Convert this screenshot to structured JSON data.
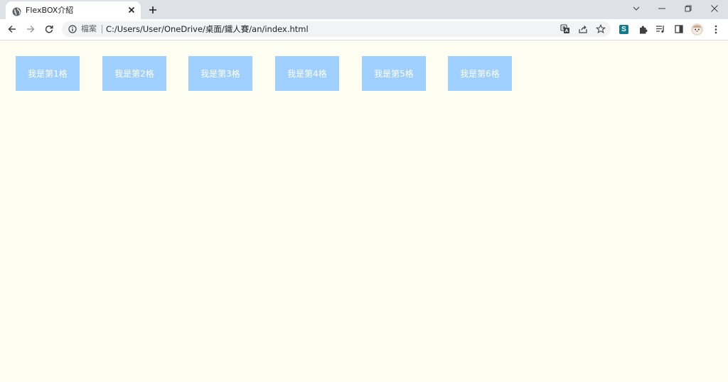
{
  "browser": {
    "tab": {
      "title": "FlexBOX介紹",
      "favicon": "globe-icon"
    },
    "new_tab_icon": "plus-icon",
    "window_controls": [
      "chevron-down-icon",
      "minimize-icon",
      "restore-icon",
      "close-icon"
    ],
    "toolbar": {
      "back_icon": "back-arrow-icon",
      "forward_icon": "forward-arrow-icon",
      "reload_icon": "reload-icon"
    },
    "omnibox": {
      "security_icon": "info-icon",
      "security_label": "檔案",
      "url": "C:/Users/User/OneDrive/桌面/鐵人賽/an/index.html",
      "icons": [
        "translate-icon",
        "share-icon",
        "star-icon"
      ]
    },
    "extensions": {
      "s_extension_label": "S",
      "icons": [
        "puzzle-icon",
        "reading-list-icon",
        "side-panel-icon",
        "avatar",
        "kebab-menu-icon"
      ]
    }
  },
  "page": {
    "background": "#fdfdf1",
    "item_color": "#9fcfff",
    "items": [
      {
        "label": "我是第1格"
      },
      {
        "label": "我是第2格"
      },
      {
        "label": "我是第3格"
      },
      {
        "label": "我是第4格"
      },
      {
        "label": "我是第5格"
      },
      {
        "label": "我是第6格"
      }
    ]
  }
}
